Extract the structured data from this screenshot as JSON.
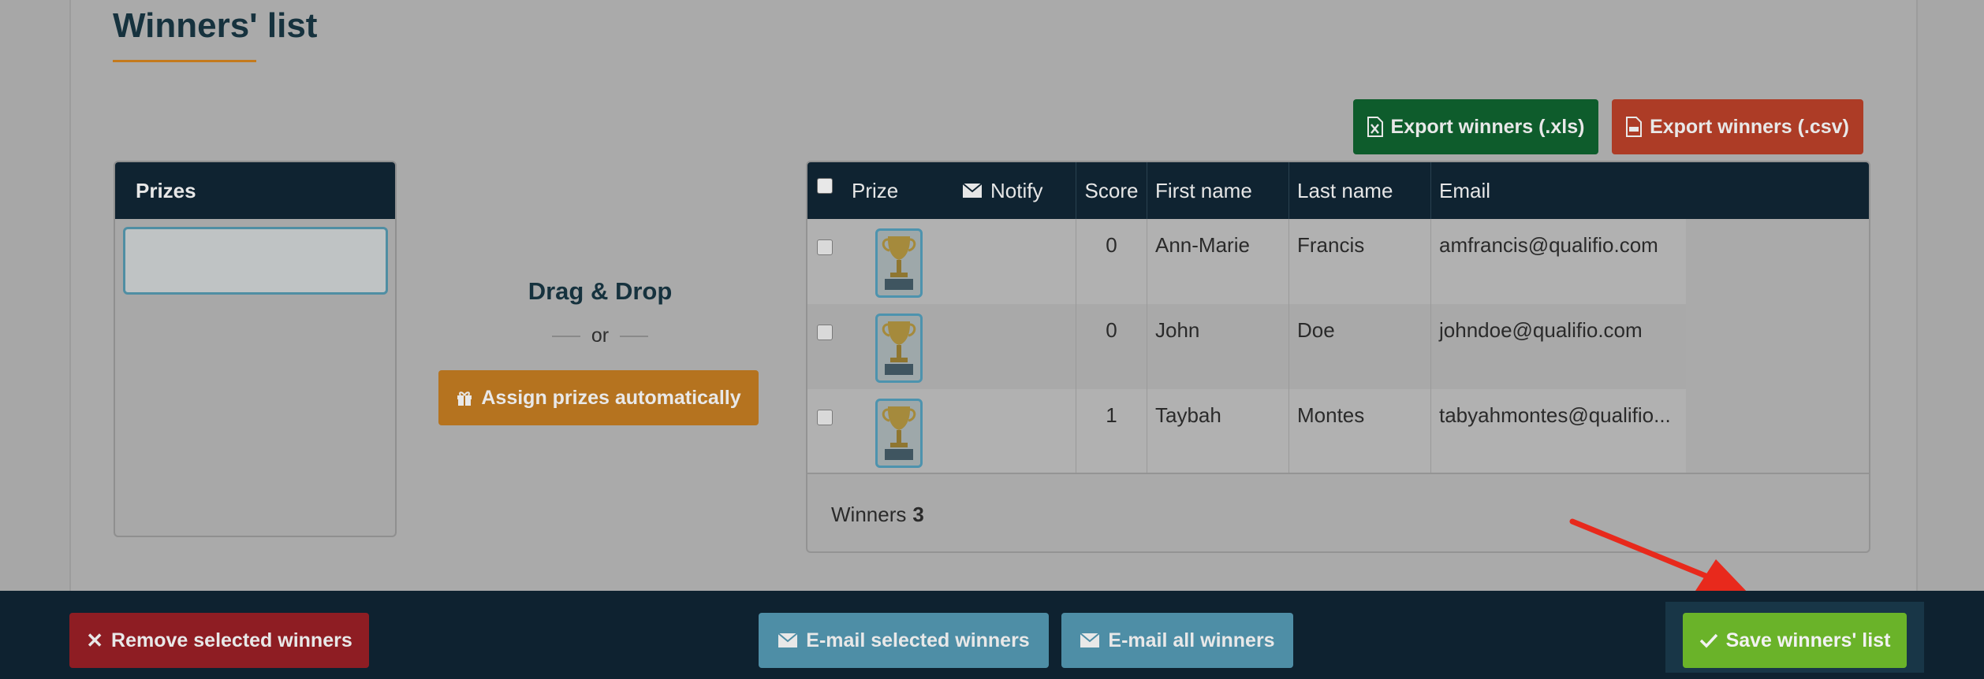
{
  "page": {
    "title": "Winners' list"
  },
  "export": {
    "xls_label": "Export winners (.xls)",
    "csv_label": "Export winners (.csv)"
  },
  "prizes": {
    "header": "Prizes"
  },
  "assign": {
    "drag_drop": "Drag & Drop",
    "or": "or",
    "auto_label": "Assign prizes automatically"
  },
  "table": {
    "headers": {
      "prize": "Prize",
      "notify": "Notify",
      "score": "Score",
      "first_name": "First name",
      "last_name": "Last name",
      "email": "Email"
    },
    "rows": [
      {
        "score": "0",
        "first_name": "Ann-Marie",
        "last_name": "Francis",
        "email": "amfrancis@qualifio.com",
        "prize_icon": "trophy-icon"
      },
      {
        "score": "0",
        "first_name": "John",
        "last_name": "Doe",
        "email": "johndoe@qualifio.com",
        "prize_icon": "trophy-icon"
      },
      {
        "score": "1",
        "first_name": "Taybah",
        "last_name": "Montes",
        "email": "tabyahmontes@qualifio...",
        "prize_icon": "trophy-icon"
      }
    ],
    "footer": {
      "label": "Winners",
      "count": "3"
    }
  },
  "actions": {
    "remove_label": "Remove selected winners",
    "email_selected_label": "E-mail selected winners",
    "email_all_label": "E-mail all winners",
    "save_label": "Save winners' list"
  },
  "colors": {
    "header_bg": "#0f2331",
    "export_xls": "#0e5c2c",
    "export_csv": "#ad3c26",
    "assign": "#b5731f",
    "remove": "#8e1d23",
    "email": "#4e8ea6",
    "save": "#6ab329",
    "annotation_arrow": "#e8291c"
  }
}
